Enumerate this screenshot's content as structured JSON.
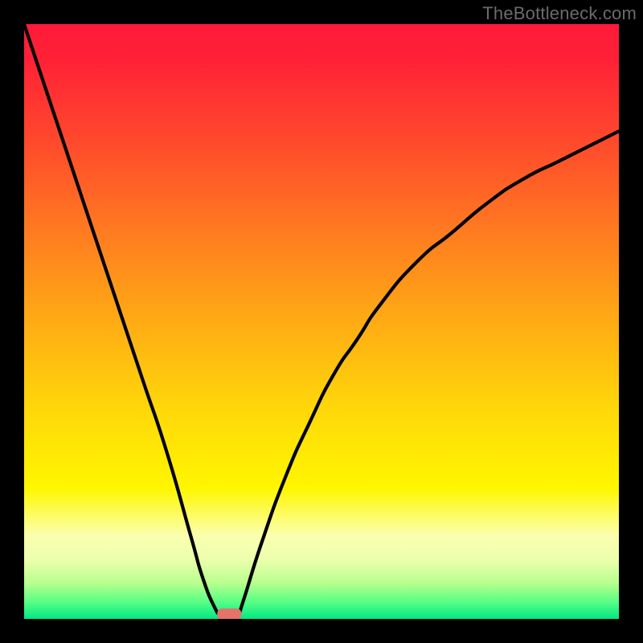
{
  "watermark": "TheBottleneck.com",
  "gradient_stops": [
    {
      "offset": 0.0,
      "color": "#ff1a3a"
    },
    {
      "offset": 0.06,
      "color": "#ff2136"
    },
    {
      "offset": 0.2,
      "color": "#ff4a2c"
    },
    {
      "offset": 0.35,
      "color": "#ff7b20"
    },
    {
      "offset": 0.5,
      "color": "#ffab14"
    },
    {
      "offset": 0.65,
      "color": "#ffd80a"
    },
    {
      "offset": 0.78,
      "color": "#fff600"
    },
    {
      "offset": 0.86,
      "color": "#fbffb0"
    },
    {
      "offset": 0.9,
      "color": "#ecffad"
    },
    {
      "offset": 0.94,
      "color": "#b7ff8e"
    },
    {
      "offset": 0.97,
      "color": "#5cff84"
    },
    {
      "offset": 1.0,
      "color": "#00e884"
    }
  ],
  "chart_data": {
    "type": "line",
    "title": "",
    "xlabel": "",
    "ylabel": "",
    "xlim": [
      0,
      100
    ],
    "ylim": [
      0,
      100
    ],
    "grid": false,
    "legend": false,
    "series": [
      {
        "name": "bottleneck-curve",
        "x": [
          0,
          4,
          8,
          12,
          16,
          20,
          24,
          28,
          30,
          32,
          33,
          34,
          35,
          36,
          37,
          40,
          44,
          48,
          52,
          56,
          60,
          66,
          72,
          78,
          84,
          90,
          96,
          100
        ],
        "values": [
          100,
          88,
          76,
          64,
          52,
          40,
          28,
          14,
          7,
          2,
          0.8,
          0.4,
          0.4,
          0.8,
          3.5,
          13,
          24,
          33,
          41,
          47,
          53,
          60,
          65,
          70,
          74,
          77,
          80,
          82
        ]
      }
    ],
    "annotations": [
      {
        "name": "min-marker",
        "x": 34.5,
        "y": 0.8,
        "color": "#e5736c",
        "shape": "rounded-bar"
      }
    ]
  }
}
